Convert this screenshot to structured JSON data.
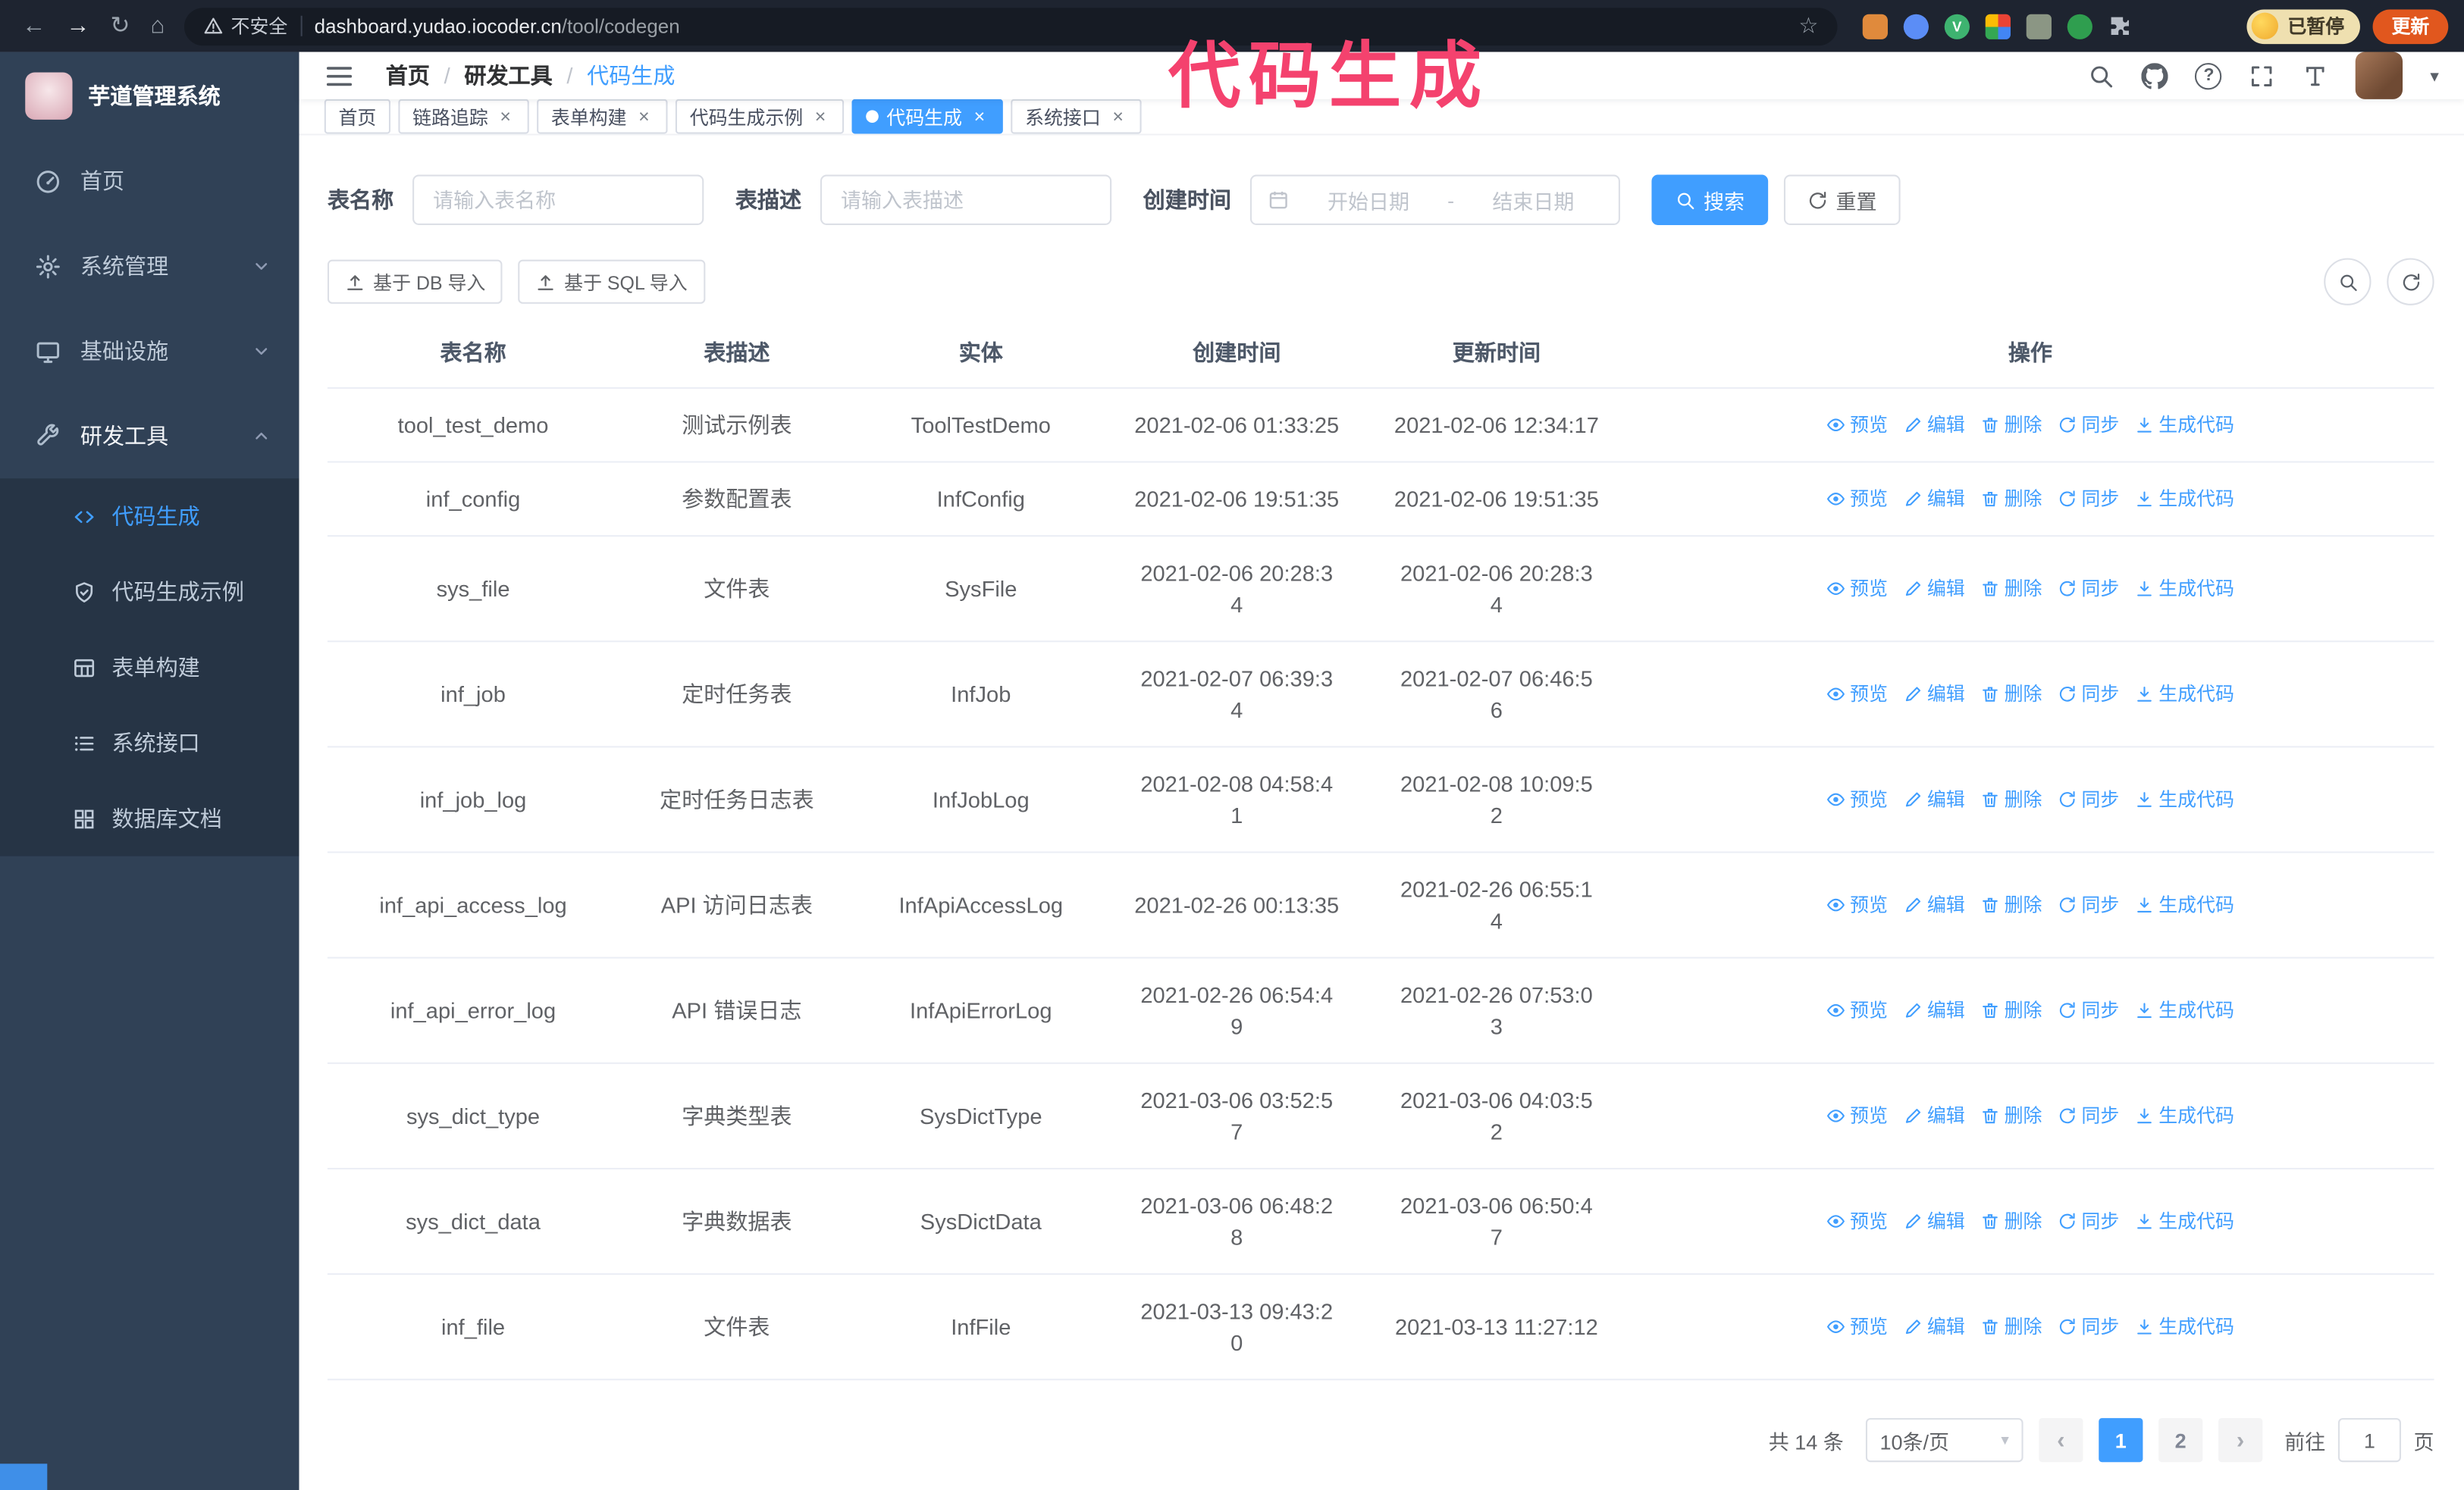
{
  "icons": {
    "back": "←",
    "forward": "→",
    "reload": "↻",
    "home": "⌂",
    "star": "☆",
    "close": "×",
    "caret": "▾",
    "question": "?",
    "prev": "‹",
    "next": "›"
  },
  "browser": {
    "security_warning": "不安全",
    "url_host": "dashboard.yudao.iocoder.cn",
    "url_path": "/tool/codegen",
    "paused_badge": "已暂停",
    "update_button": "更新"
  },
  "annotation": {
    "text": "代码生成",
    "color": "#f4426e"
  },
  "sidebar": {
    "logo_title": "芋道管理系统",
    "items": [
      {
        "label": "首页",
        "icon": "gauge-icon"
      },
      {
        "label": "系统管理",
        "icon": "gear-icon",
        "expandable": true
      },
      {
        "label": "基础设施",
        "icon": "monitor-icon",
        "expandable": true
      },
      {
        "label": "研发工具",
        "icon": "wrench-icon",
        "expanded": true
      }
    ],
    "subitems": [
      {
        "label": "代码生成",
        "icon": "code-icon",
        "active": true
      },
      {
        "label": "代码生成示例",
        "icon": "shield-icon"
      },
      {
        "label": "表单构建",
        "icon": "table-icon"
      },
      {
        "label": "系统接口",
        "icon": "list-icon"
      },
      {
        "label": "数据库文档",
        "icon": "grid-icon"
      }
    ]
  },
  "header": {
    "breadcrumb": [
      "首页",
      "研发工具",
      "代码生成"
    ]
  },
  "tabs": [
    {
      "label": "首页",
      "closable": false,
      "active": false
    },
    {
      "label": "链路追踪",
      "closable": true,
      "active": false
    },
    {
      "label": "表单构建",
      "closable": true,
      "active": false
    },
    {
      "label": "代码生成示例",
      "closable": true,
      "active": false
    },
    {
      "label": "代码生成",
      "closable": true,
      "active": true
    },
    {
      "label": "系统接口",
      "closable": true,
      "active": false
    }
  ],
  "filters": {
    "table_name_label": "表名称",
    "table_name_placeholder": "请输入表名称",
    "table_desc_label": "表描述",
    "table_desc_placeholder": "请输入表描述",
    "create_time_label": "创建时间",
    "date_start_placeholder": "开始日期",
    "date_separator": "-",
    "date_end_placeholder": "结束日期",
    "search_button": "搜索",
    "reset_button": "重置"
  },
  "toolbar": {
    "import_db": "基于 DB 导入",
    "import_sql": "基于 SQL 导入"
  },
  "table": {
    "columns": [
      "表名称",
      "表描述",
      "实体",
      "创建时间",
      "更新时间",
      "操作"
    ],
    "actions": [
      "预览",
      "编辑",
      "删除",
      "同步",
      "生成代码"
    ],
    "rows": [
      {
        "name": "tool_test_demo",
        "desc": "测试示例表",
        "entity": "ToolTestDemo",
        "created": "2021-02-06 01:33:25",
        "updated": "2021-02-06 12:34:17"
      },
      {
        "name": "inf_config",
        "desc": "参数配置表",
        "entity": "InfConfig",
        "created": "2021-02-06 19:51:35",
        "updated": "2021-02-06 19:51:35"
      },
      {
        "name": "sys_file",
        "desc": "文件表",
        "entity": "SysFile",
        "created": "2021-02-06 20:28:3\n4",
        "updated": "2021-02-06 20:28:3\n4"
      },
      {
        "name": "inf_job",
        "desc": "定时任务表",
        "entity": "InfJob",
        "created": "2021-02-07 06:39:3\n4",
        "updated": "2021-02-07 06:46:5\n6"
      },
      {
        "name": "inf_job_log",
        "desc": "定时任务日志表",
        "entity": "InfJobLog",
        "created": "2021-02-08 04:58:4\n1",
        "updated": "2021-02-08 10:09:5\n2"
      },
      {
        "name": "inf_api_access_log",
        "desc": "API 访问日志表",
        "entity": "InfApiAccessLog",
        "created": "2021-02-26 00:13:35",
        "updated": "2021-02-26 06:55:1\n4"
      },
      {
        "name": "inf_api_error_log",
        "desc": "API 错误日志",
        "entity": "InfApiErrorLog",
        "created": "2021-02-26 06:54:4\n9",
        "updated": "2021-02-26 07:53:0\n3"
      },
      {
        "name": "sys_dict_type",
        "desc": "字典类型表",
        "entity": "SysDictType",
        "created": "2021-03-06 03:52:5\n7",
        "updated": "2021-03-06 04:03:5\n2"
      },
      {
        "name": "sys_dict_data",
        "desc": "字典数据表",
        "entity": "SysDictData",
        "created": "2021-03-06 06:48:2\n8",
        "updated": "2021-03-06 06:50:4\n7"
      },
      {
        "name": "inf_file",
        "desc": "文件表",
        "entity": "InfFile",
        "created": "2021-03-13 09:43:2\n0",
        "updated": "2021-03-13 11:27:12"
      }
    ]
  },
  "pagination": {
    "total": "共 14 条",
    "page_size": "10条/页",
    "pages": [
      "1",
      "2"
    ],
    "active_page": "1",
    "goto_label": "前往",
    "goto_value": "1",
    "goto_unit": "页"
  }
}
